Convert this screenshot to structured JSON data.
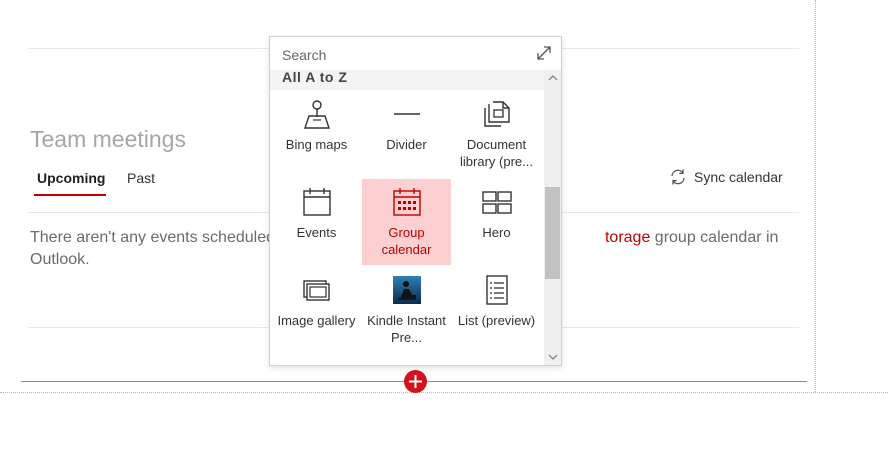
{
  "section": {
    "title": "Team meetings",
    "tabs": [
      {
        "label": "Upcoming",
        "active": true
      },
      {
        "label": "Past",
        "active": false
      }
    ],
    "sync_label": "Sync calendar",
    "empty_message_start": "There aren't any events scheduled",
    "empty_message_link": "torage",
    "empty_message_end": " group calendar in Outlook."
  },
  "toolbox": {
    "search_placeholder": "Search",
    "list_header": "All A to Z",
    "items": [
      {
        "label": "Bing maps",
        "icon": "map-pin-icon",
        "selected": false
      },
      {
        "label": "Divider",
        "icon": "divider-icon",
        "selected": false
      },
      {
        "label": "Document library (pre...",
        "icon": "document-library-icon",
        "selected": false
      },
      {
        "label": "Events",
        "icon": "events-calendar-icon",
        "selected": false
      },
      {
        "label": "Group calendar",
        "icon": "group-calendar-icon",
        "selected": true
      },
      {
        "label": "Hero",
        "icon": "hero-layout-icon",
        "selected": false
      },
      {
        "label": "Image gallery",
        "icon": "image-gallery-icon",
        "selected": false
      },
      {
        "label": "Kindle Instant Pre...",
        "icon": "kindle-reader-icon",
        "selected": false
      },
      {
        "label": "List (preview)",
        "icon": "list-icon",
        "selected": false
      }
    ]
  },
  "colors": {
    "accent": "#c00000",
    "selected_tile_bg": "#fccfd0",
    "add_button": "#d2121c"
  }
}
